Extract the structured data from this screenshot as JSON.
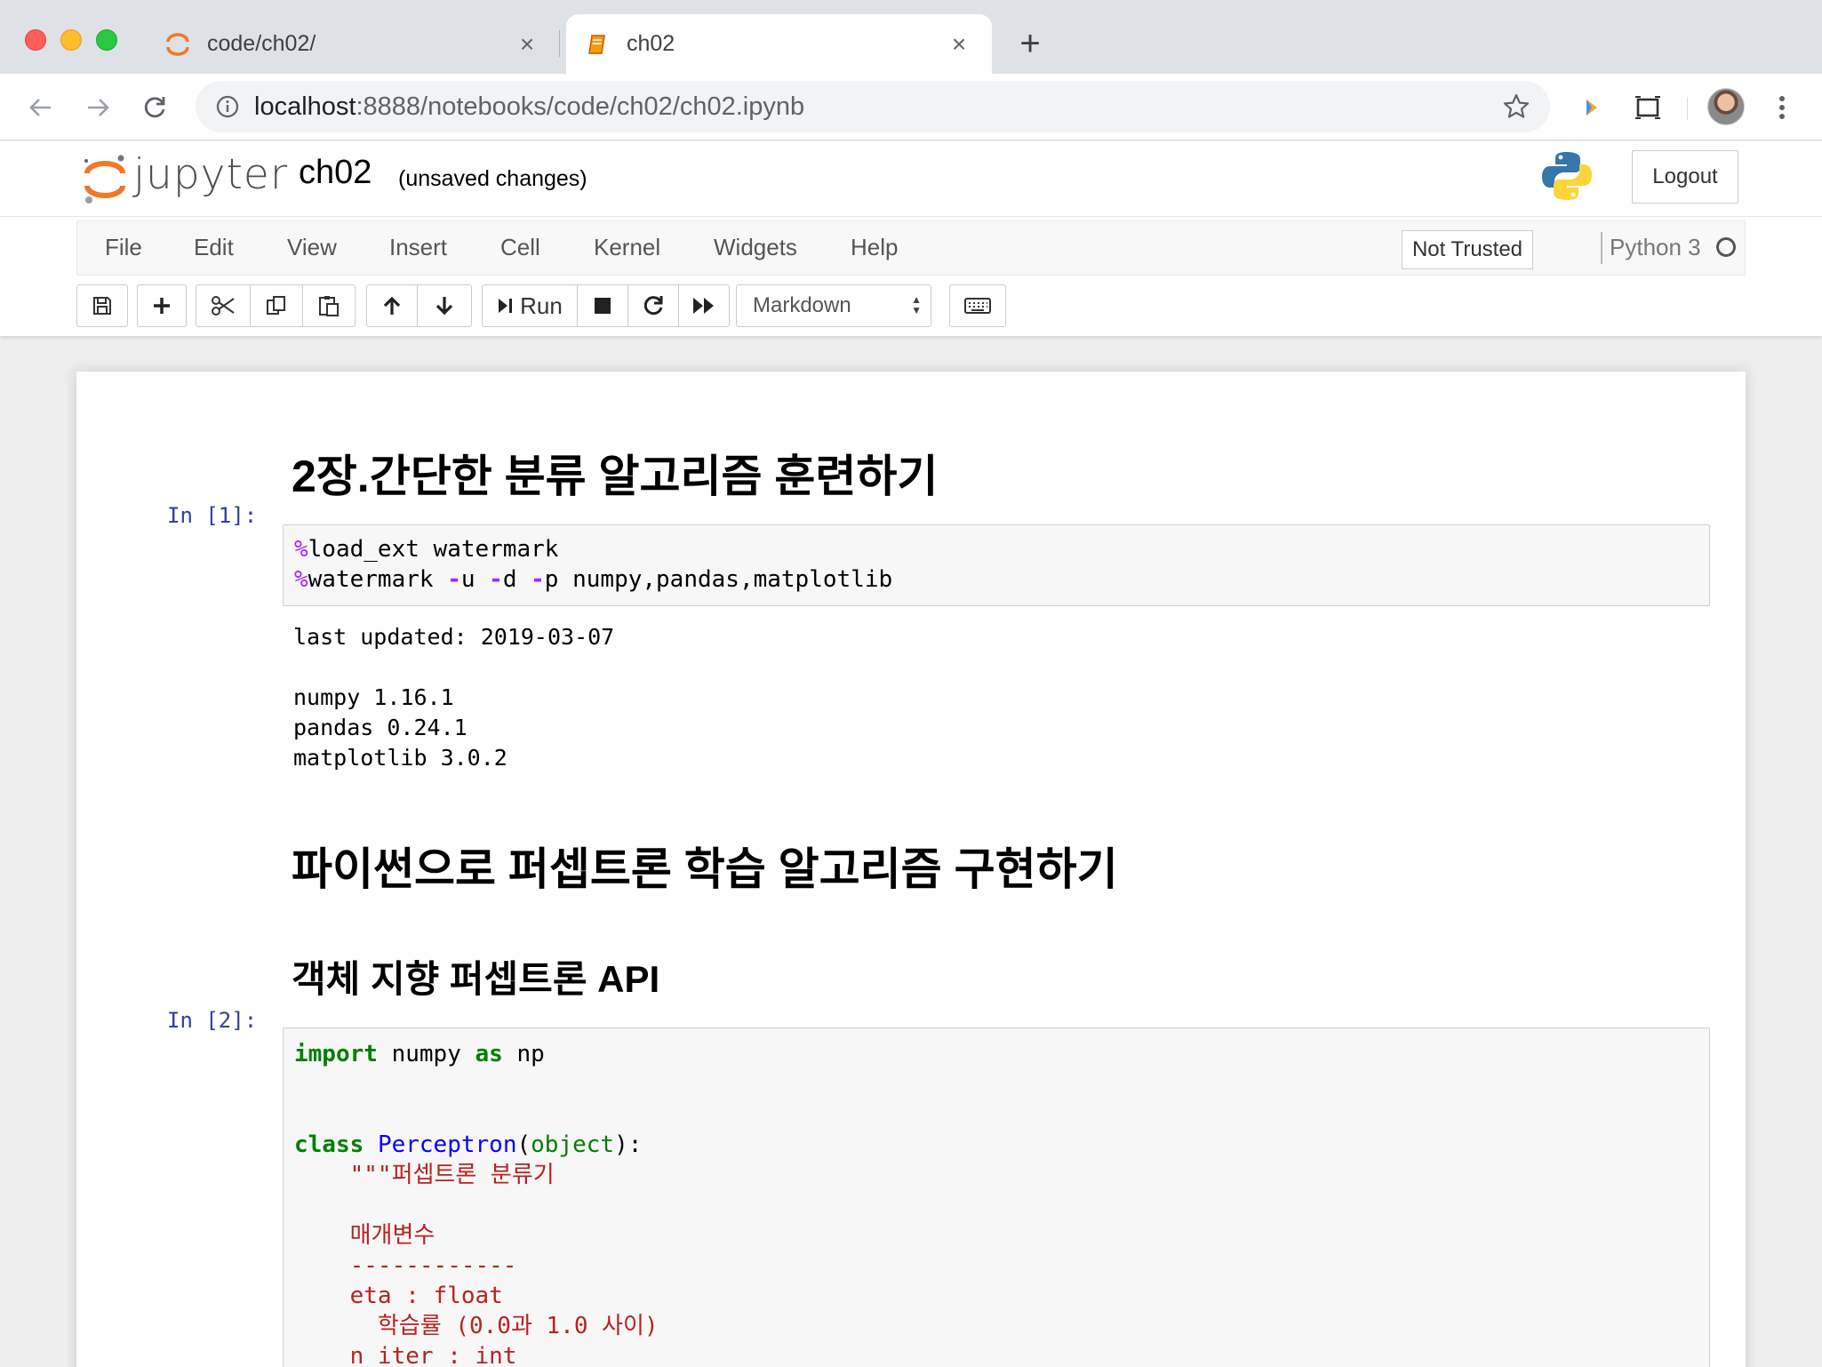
{
  "browser": {
    "tabs": [
      {
        "title": "code/ch02/",
        "icon": "jupyter-icon",
        "active": false
      },
      {
        "title": "ch02",
        "icon": "notebook-icon",
        "active": true
      }
    ],
    "url_host": "localhost",
    "url_path": ":8888/notebooks/code/ch02/ch02.ipynb"
  },
  "header": {
    "logo_text": "jupyter",
    "notebook_name": "ch02",
    "save_status": "(unsaved changes)",
    "logout_label": "Logout"
  },
  "menubar": {
    "items": [
      "File",
      "Edit",
      "View",
      "Insert",
      "Cell",
      "Kernel",
      "Widgets",
      "Help"
    ],
    "trust_label": "Not Trusted",
    "kernel_name": "Python 3"
  },
  "toolbar": {
    "run_label": "Run",
    "cell_type": "Markdown"
  },
  "cells": {
    "heading_1": "2장.간단한 분류 알고리즘 훈련하기",
    "cell1": {
      "prompt": "In [1]:",
      "outputs": [
        "last updated: 2019-03-07",
        "numpy 1.16.1",
        "pandas 0.24.1",
        "matplotlib 3.0.2"
      ]
    },
    "heading_2": "파이썬으로 퍼셉트론 학습 알고리즘 구현하기",
    "heading_3": "객체 지향 퍼셉트론 API",
    "cell2": {
      "prompt": "In [2]:",
      "docstring_lines": [
        "\"\"\"퍼셉트론 분류기",
        "매개변수",
        "------------",
        "eta : float",
        "학습률 (0.0과 1.0 사이)",
        "n_iter : int"
      ]
    }
  },
  "colors": {
    "prompt_in": "#303f9f",
    "keyword": "#008000",
    "magic": "#aa22ff",
    "class_name": "#0000ff",
    "string": "#ba2121"
  }
}
